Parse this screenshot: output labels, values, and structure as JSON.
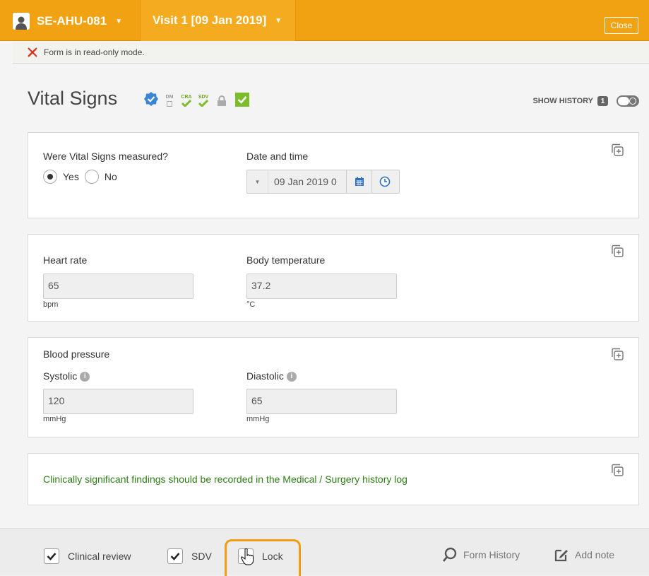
{
  "topbar": {
    "subject_label": "SE-AHU-081",
    "visit_label": "Visit 1 [09 Jan 2019]",
    "close_label": "Close"
  },
  "readonly": {
    "message": "Form is in read-only mode."
  },
  "form": {
    "title": "Vital Signs",
    "badges": {
      "dm": "DM",
      "cra": "CRA",
      "sdv": "SDV"
    },
    "show_history_label": "SHOW HISTORY",
    "history_count": "1"
  },
  "section1": {
    "measured_label": "Were Vital Signs measured?",
    "yes_label": "Yes",
    "no_label": "No",
    "selected": "Yes",
    "datetime_label": "Date and time",
    "datetime_value": "09 Jan 2019 0"
  },
  "section2": {
    "heart_rate_label": "Heart rate",
    "heart_rate_value": "65",
    "heart_rate_unit": "bpm",
    "temp_label": "Body temperature",
    "temp_value": "37.2",
    "temp_unit": "°C"
  },
  "section3": {
    "bp_label": "Blood pressure",
    "systolic_label": "Systolic",
    "systolic_value": "120",
    "systolic_unit": "mmHg",
    "diastolic_label": "Diastolic",
    "diastolic_value": "65",
    "diastolic_unit": "mmHg"
  },
  "section4": {
    "note": "Clinically significant findings should be recorded in the Medical / Surgery history log"
  },
  "bottom": {
    "clinical_review_label": "Clinical review",
    "clinical_review_checked": true,
    "sdv_label": "SDV",
    "sdv_checked": true,
    "lock_label": "Lock",
    "lock_checked": false,
    "form_history_label": "Form History",
    "add_note_label": "Add note"
  },
  "colors": {
    "header": "#f0a213",
    "accent_green": "#7cbd2a",
    "note_green": "#2d7d14",
    "highlight": "#f39c12"
  }
}
